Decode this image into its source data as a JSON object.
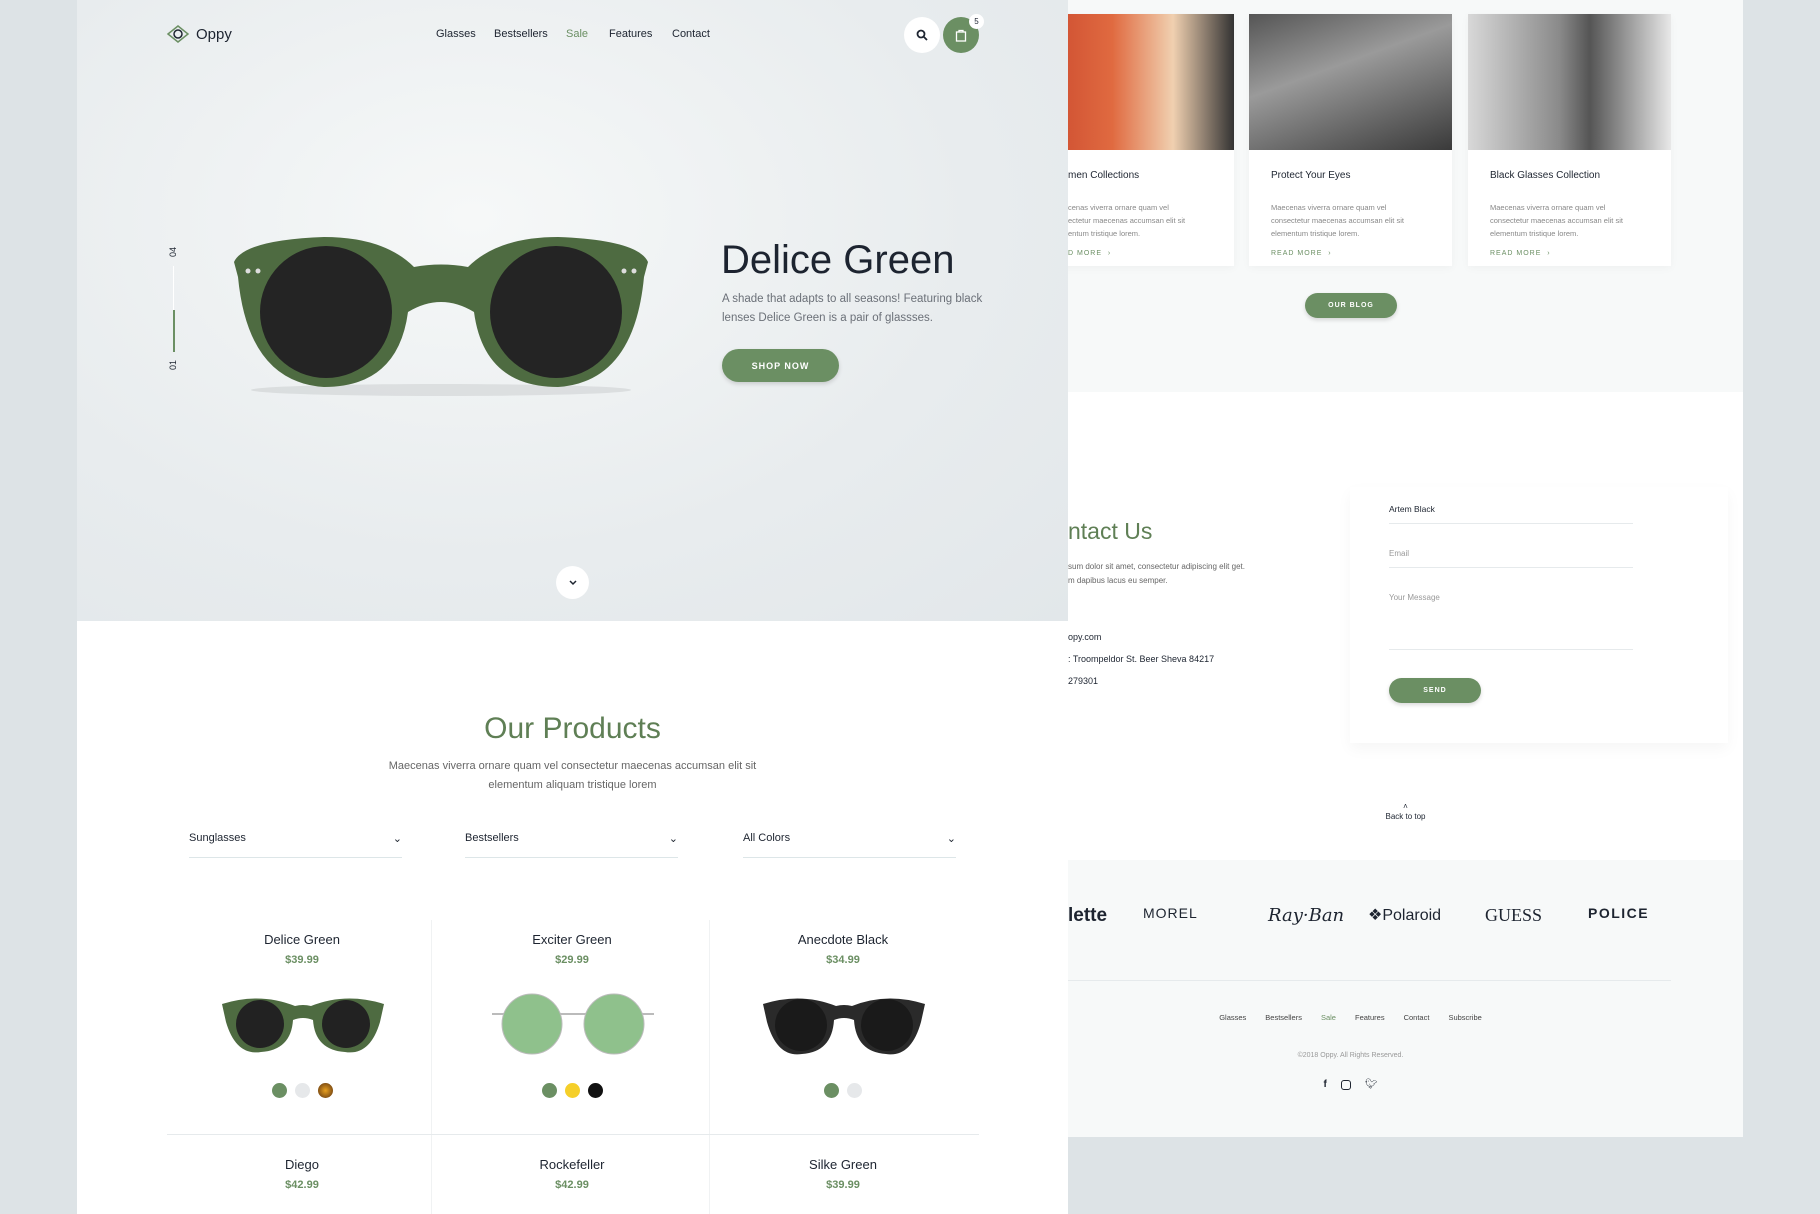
{
  "header": {
    "logo": "Oppy",
    "nav": [
      "Glasses",
      "Bestsellers",
      "Sale",
      "Features",
      "Contact"
    ],
    "active": "Sale",
    "cart_count": "5"
  },
  "hero": {
    "slide_current": "01",
    "slide_total": "04",
    "title": "Delice Green",
    "desc1": "A shade that adapts to all seasons! Featuring black",
    "desc2": "lenses Delice Green is a pair of glassses.",
    "cta": "SHOP NOW"
  },
  "products": {
    "title": "Our Products",
    "desc1": "Maecenas viverra ornare quam vel consectetur maecenas accumsan elit sit",
    "desc2": "elementum aliquam tristique lorem",
    "filters": [
      "Sunglasses",
      "Bestsellers",
      "All Colors"
    ],
    "items": [
      {
        "name": "Delice Green",
        "price": "$39.99"
      },
      {
        "name": "Exciter Green",
        "price": "$29.99"
      },
      {
        "name": "Anecdote Black",
        "price": "$34.99"
      },
      {
        "name": "Diego",
        "price": "$42.99"
      },
      {
        "name": "Rockefeller",
        "price": "$42.99"
      },
      {
        "name": "Silke Green",
        "price": "$39.99"
      }
    ]
  },
  "blog": {
    "cards": [
      {
        "title": "men Collections",
        "l1": "cenas viverra ornare quam vel",
        "l2": "ectetur maecenas accumsan elit sit",
        "l3": "entum tristique lorem.",
        "more": "D MORE"
      },
      {
        "title": "Protect Your Eyes",
        "l1": "Maecenas viverra ornare quam vel",
        "l2": "consectetur maecenas accumsan elit sit",
        "l3": "elementum tristique lorem.",
        "more": "READ MORE"
      },
      {
        "title": "Black Glasses Collection",
        "l1": "Maecenas viverra ornare quam vel",
        "l2": "consectetur maecenas accumsan elit sit",
        "l3": "elementum tristique lorem.",
        "more": "READ MORE"
      }
    ],
    "button": "OUR BLOG"
  },
  "contact": {
    "title": "ntact Us",
    "text1": "sum dolor sit amet, consectetur adipiscing elit get.",
    "text2": "m dapibus lacus eu semper.",
    "email": "opy.com",
    "address": ": Troompeldor St. Beer Sheva 84217",
    "phone": "279301",
    "name_value": "Artem Black",
    "email_placeholder": "Email",
    "message_placeholder": "Your Message",
    "send": "SEND",
    "back_to_top": "Back to top"
  },
  "brands": [
    "lette",
    "MOREL",
    "Ray·Ban",
    "❖Polaroid",
    "GUESS",
    "POLICE"
  ],
  "footer": {
    "nav": [
      "Glasses",
      "Bestsellers",
      "Sale",
      "Features",
      "Contact",
      "Subscribe"
    ],
    "copyright": "©2018 Oppy. All Rights Reserved."
  },
  "colors": {
    "accent": "#6b8f63",
    "text": "#1d2430",
    "bg": "#dde3e6"
  }
}
